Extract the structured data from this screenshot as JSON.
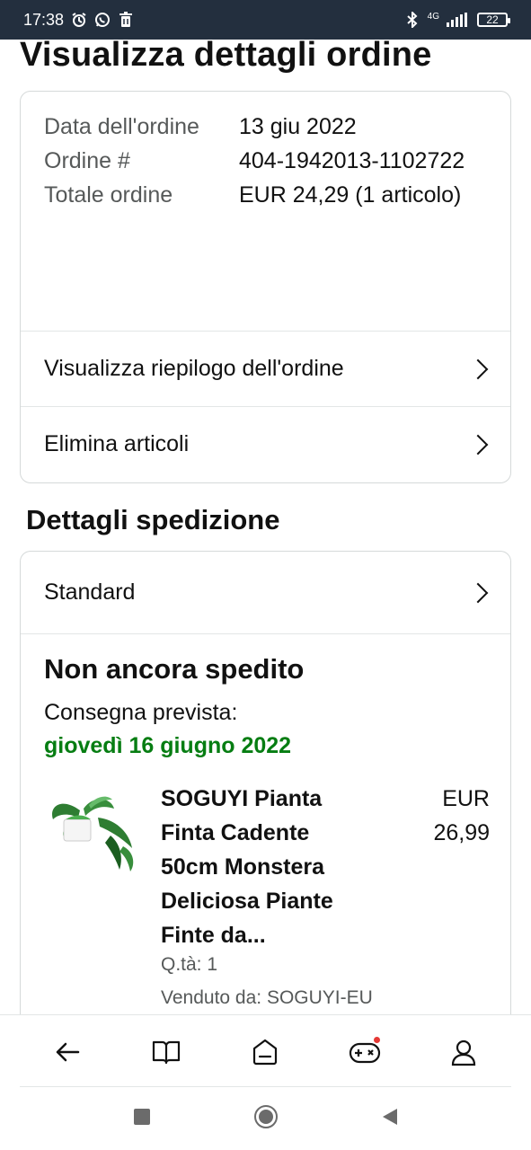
{
  "status_bar": {
    "time": "17:38",
    "network": "4G",
    "battery": "22"
  },
  "page": {
    "title": "Visualizza dettagli ordine"
  },
  "order": {
    "date_label": "Data dell'ordine",
    "date_value": "13 giu 2022",
    "number_label": "Ordine #",
    "number_value": "404-1942013-1102722",
    "total_label": "Totale ordine",
    "total_value": "EUR 24,29 (1 articolo)",
    "summary_link": "Visualizza riepilogo dell'ordine",
    "delete_link": "Elimina articoli"
  },
  "shipping": {
    "section_title": "Dettagli spedizione",
    "method": "Standard",
    "status": "Non ancora spedito",
    "delivery_label": "Consegna prevista:",
    "delivery_date": "giovedì 16 giugno 2022",
    "delivery_color": "#067d12"
  },
  "product": {
    "title": "SOGUYI Pianta Finta Cadente 50cm Monstera Deliciosa Piante Finte da...",
    "price": "EUR 26,99",
    "qty": "Q.tà: 1",
    "seller": "Venduto da: SOGUYI-EU",
    "image_icon": "plant-image"
  },
  "bottom_nav": {
    "items": [
      "back-icon",
      "book-icon",
      "home-icon",
      "gamepad-icon",
      "profile-icon"
    ],
    "notification_color": "#e53935"
  },
  "system_nav": {
    "items": [
      "recents-icon",
      "home-circle-icon",
      "back-triangle-icon"
    ]
  },
  "colors": {
    "status_bar_bg": "#232f3e",
    "label_gray": "#565959",
    "border": "#d5d9d9"
  }
}
